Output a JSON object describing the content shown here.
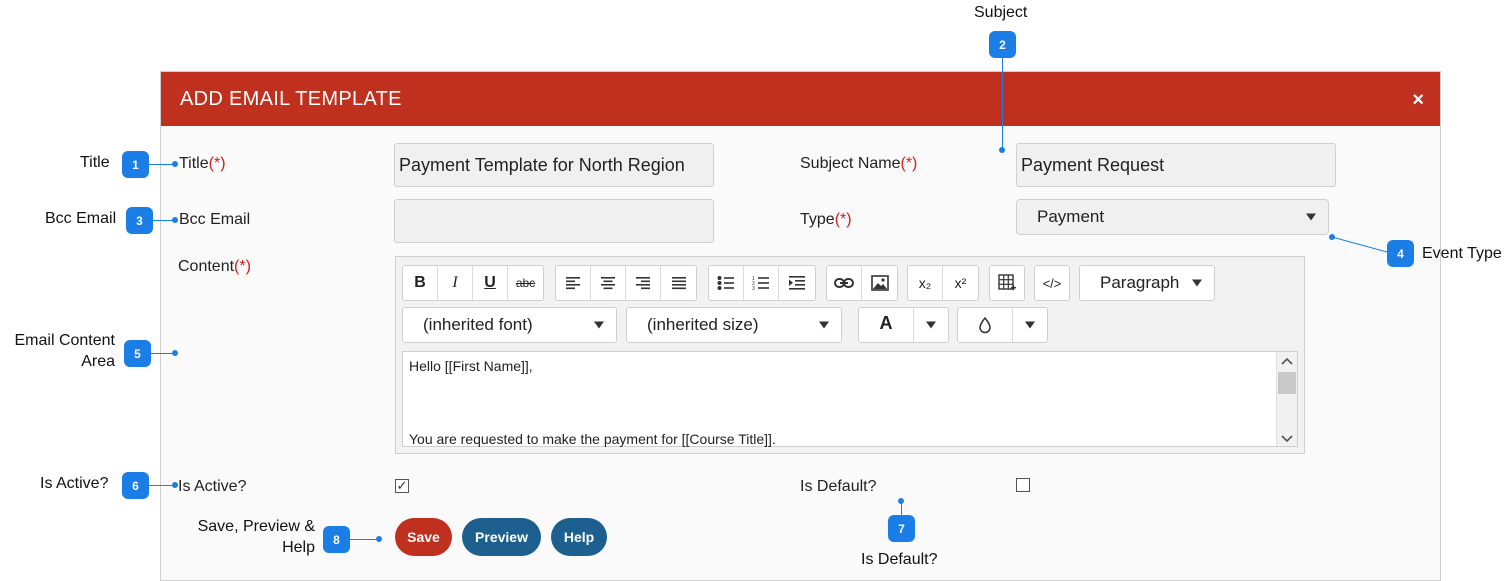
{
  "modal": {
    "title": "ADD EMAIL TEMPLATE",
    "close_symbol": "×"
  },
  "form": {
    "title_label": "Title",
    "subject_label": "Subject Name",
    "bcc_label": "Bcc Email",
    "type_label": "Type",
    "content_label": "Content",
    "required_mark": "(*)",
    "title_value": "Payment Template for North Region",
    "subject_value": "Payment Request",
    "bcc_value": "",
    "type_value": "Payment",
    "is_active_label": "Is Active?",
    "is_default_label": "Is Default?",
    "is_active_checked": true,
    "is_default_checked": false,
    "is_active_mark": "✓",
    "is_default_mark": ""
  },
  "editor": {
    "toolbar": {
      "bold": "B",
      "italic": "I",
      "underline": "U",
      "strike": "abc",
      "subscript": "x₂",
      "superscript": "x²",
      "code": "</>",
      "format_select": "Paragraph",
      "font_select": "(inherited font)",
      "size_select": "(inherited size)",
      "text_color": "A"
    },
    "content_lines": [
      "Hello [[First Name]],",
      "You are requested to make the payment for [[Course Title]]."
    ]
  },
  "buttons": {
    "save": "Save",
    "preview": "Preview",
    "help": "Help"
  },
  "annotations": {
    "title": {
      "num": "1",
      "label": "Title"
    },
    "subject": {
      "num": "2",
      "label": "Subject"
    },
    "bcc": {
      "num": "3",
      "label": "Bcc Email"
    },
    "event_type": {
      "num": "4",
      "label": "Event Type"
    },
    "content_line1": "Email Content",
    "content_line2": "Area",
    "content_num": "5",
    "is_active": {
      "num": "6",
      "label": "Is Active?"
    },
    "is_default": {
      "num": "7",
      "label": "Is Default?"
    },
    "save_line1": "Save, Preview &",
    "save_line2": "Help",
    "save_num": "8"
  },
  "colors": {
    "header": "#c0301f",
    "save_button": "#c0301f",
    "secondary_button": "#1d5f8e",
    "annotation": "#1a7ee6",
    "required": "#d21f1f"
  }
}
